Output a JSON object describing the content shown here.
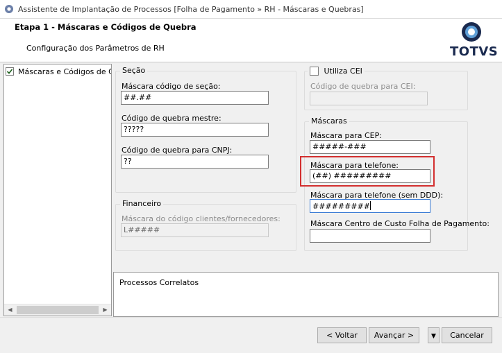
{
  "window": {
    "title": "Assistente de Implantação de Processos [Folha de Pagamento » RH - Máscaras e Quebras]"
  },
  "header": {
    "step_title": "Etapa 1 - Máscaras e Códigos de Quebra",
    "subtitle": "Configuração dos Parâmetros de RH",
    "brand": "TOTVS"
  },
  "tree": {
    "items": [
      {
        "label": "Máscaras e Códigos de Quebra",
        "checked": true
      }
    ]
  },
  "secao": {
    "legend": "Seção",
    "mascara_codigo_secao": {
      "label": "Máscara código de seção:",
      "value": "##.##"
    },
    "codigo_quebra_mestre": {
      "label": "Código de quebra mestre:",
      "value": "?????"
    },
    "codigo_quebra_cnpj": {
      "label": "Código de quebra para CNPJ:",
      "value": "??"
    }
  },
  "financeiro": {
    "legend": "Financeiro",
    "mascara_clientes_fornecedores": {
      "label": "Máscara do código clientes/fornecedores:",
      "value": "L#####"
    }
  },
  "cei": {
    "checkbox_label": "Utiliza CEI",
    "checked": false,
    "codigo_quebra_cei": {
      "label": "Código de quebra para CEI:",
      "value": ""
    }
  },
  "mascaras": {
    "legend": "Máscaras",
    "cep": {
      "label": "Máscara para CEP:",
      "value": "#####-###"
    },
    "telefone": {
      "label": "Máscara para telefone:",
      "value": "(##) #########"
    },
    "telefone_sem_ddd": {
      "label": "Máscara para telefone (sem DDD):",
      "value": "#########"
    },
    "centro_custo": {
      "label": "Máscara Centro de Custo Folha de Pagamento:",
      "value": ""
    }
  },
  "related": {
    "label": "Processos Correlatos"
  },
  "buttons": {
    "back": "< Voltar",
    "next": "Avançar >",
    "cancel": "Cancelar"
  },
  "colors": {
    "highlight": "#d32f2f",
    "brand": "#1a2a4f"
  }
}
